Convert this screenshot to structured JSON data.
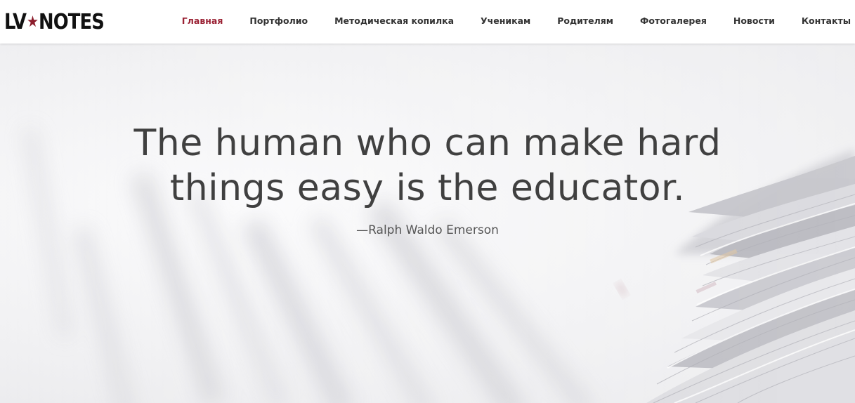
{
  "header": {
    "logo": {
      "left": "LV",
      "star": "★",
      "right": "NOTES"
    },
    "nav": [
      {
        "label": "Главная",
        "active": true
      },
      {
        "label": "Портфолио",
        "active": false
      },
      {
        "label": "Методическая копилка",
        "active": false
      },
      {
        "label": "Ученикам",
        "active": false
      },
      {
        "label": "Родителям",
        "active": false
      },
      {
        "label": "Фотогалерея",
        "active": false
      },
      {
        "label": "Новости",
        "active": false
      },
      {
        "label": "Контакты",
        "active": false
      }
    ]
  },
  "hero": {
    "quote_line1": "The human who can make hard",
    "quote_line2": "things easy is the educator.",
    "author": "—Ralph Waldo Emerson"
  },
  "colors": {
    "accent": "#9b2335",
    "text": "#404040",
    "header_bg": "#ffffff"
  }
}
